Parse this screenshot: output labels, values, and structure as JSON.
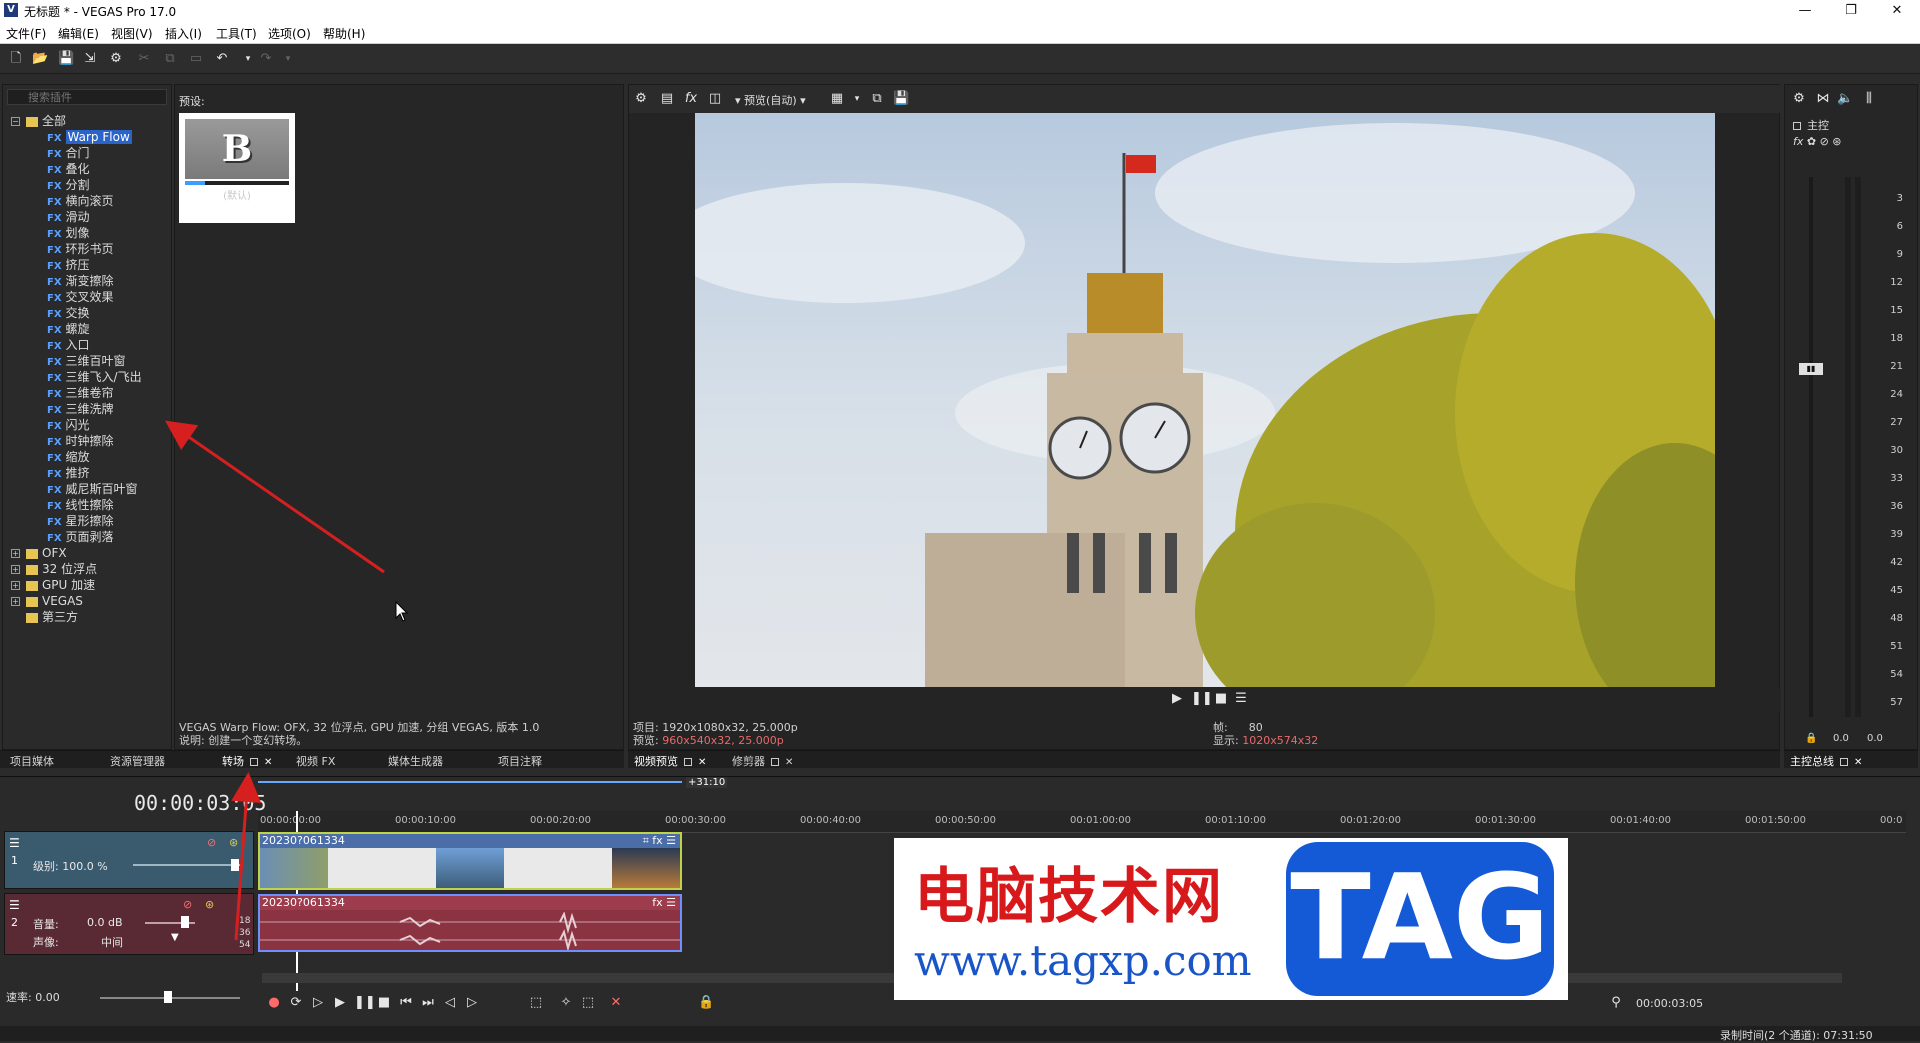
{
  "window": {
    "title": "无标题 * - VEGAS Pro 17.0",
    "app_icon_glyph": "V",
    "minimize": "—",
    "maximize": "❐",
    "close": "✕"
  },
  "menu": [
    "文件(F)",
    "编辑(E)",
    "视图(V)",
    "插入(I)",
    "工具(T)",
    "选项(O)",
    "帮助(H)"
  ],
  "plugin_tree": {
    "search_placeholder": "搜索插件",
    "root": "全部",
    "fx_tag": "FX",
    "effects": [
      "Warp Flow",
      "合门",
      "叠化",
      "分割",
      "横向滚页",
      "滑动",
      "划像",
      "环形书页",
      "挤压",
      "渐变擦除",
      "交叉效果",
      "交换",
      "螺旋",
      "入口",
      "三维百叶窗",
      "三维飞入/飞出",
      "三维卷帘",
      "三维洗牌",
      "闪光",
      "时钟擦除",
      "缩放",
      "推挤",
      "威尼斯百叶窗",
      "线性擦除",
      "星形擦除",
      "页面剥落"
    ],
    "folders": [
      "OFX",
      "32 位浮点",
      "GPU 加速",
      "VEGAS",
      "第三方"
    ],
    "selected": "Warp Flow"
  },
  "presets": {
    "label": "预设:",
    "thumb_letter": "B",
    "thumb_caption": "(默认)",
    "info_line1": "VEGAS Warp Flow: OFX, 32 位浮点, GPU 加速, 分组 VEGAS, 版本 1.0",
    "info_line2": "说明: 创建一个变幻转场。"
  },
  "left_tabs": [
    "项目媒体",
    "资源管理器",
    "转场",
    "视频 FX",
    "媒体生成器",
    "项目注释"
  ],
  "preview": {
    "toolbar_label": "预览(自动)",
    "info_project": "项目: 1920x1080x32, 25.000p",
    "info_preview_label": "预览:",
    "info_preview_value": "960x540x32, 25.000p",
    "info_frame_label": "帧:",
    "info_frame_value": "80",
    "info_display_label": "显示:",
    "info_display_value": "1020x574x32",
    "tabs": [
      "视频预览",
      "修剪器"
    ]
  },
  "master": {
    "title": "主控",
    "tab": "主控总线",
    "scale": [
      "3",
      "6",
      "9",
      "12",
      "15",
      "18",
      "21",
      "24",
      "27",
      "30",
      "33",
      "36",
      "39",
      "42",
      "45",
      "48",
      "51",
      "54",
      "57"
    ],
    "left_value": "0.0",
    "right_value": "0.0"
  },
  "timeline": {
    "timecode": "00:00:03:05",
    "region_length": "+31:10",
    "ruler_ticks": [
      "00:00:00:00",
      "00:00:10:00",
      "00:00:20:00",
      "00:00:30:00",
      "00:00:40:00",
      "00:00:50:00",
      "00:01:00:00",
      "00:01:10:00",
      "00:01:20:00",
      "00:01:30:00",
      "00:01:40:00",
      "00:01:50:00",
      "00:0"
    ],
    "video_track": {
      "number": "1",
      "level_label": "级别: 100.0 %"
    },
    "audio_track": {
      "number": "2",
      "volume_label": "音量:",
      "volume_value": "0.0 dB",
      "pan_label": "声像:",
      "pan_value": "中间",
      "meter_marks": [
        "18",
        "36",
        "54"
      ]
    },
    "video_clip_name": "20230?061334",
    "audio_clip_name": "20230?061334",
    "rate_label": "速率: 0.00",
    "cursor_time": "00:00:03:05",
    "record_time": "录制时间(2 个通道): 07:31:50"
  },
  "watermark": {
    "cn_text": "电脑技术网",
    "url": "www.tagxp.com",
    "tag": "TAG"
  },
  "colors": {
    "selection": "#2a64c8",
    "annotation_arrow": "#d62020",
    "video_clip_border": "#bdd44a",
    "audio_clip": "#8c3342",
    "watermark_red": "#d7191b",
    "watermark_blue": "#1459d6"
  }
}
